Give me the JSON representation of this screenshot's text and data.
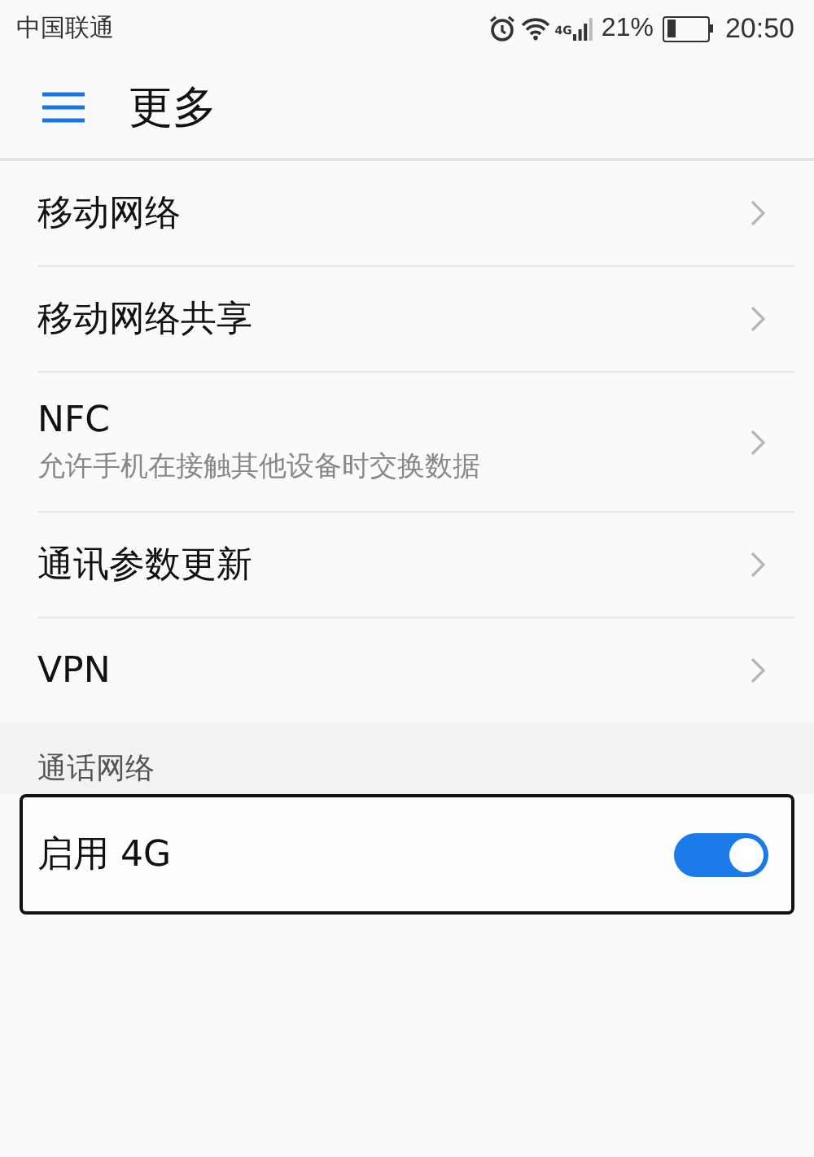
{
  "status_bar": {
    "carrier": "中国联通",
    "network_type": "4G",
    "battery_percent": "21%",
    "time": "20:50"
  },
  "toolbar": {
    "title": "更多"
  },
  "items": [
    {
      "title": "移动网络"
    },
    {
      "title": "移动网络共享"
    },
    {
      "title": "NFC",
      "subtitle": "允许手机在接触其他设备时交换数据"
    },
    {
      "title": "通讯参数更新"
    },
    {
      "title": "VPN"
    }
  ],
  "sections": [
    {
      "header": "通话网络",
      "rows": [
        {
          "label": "启用 4G",
          "on": true,
          "focused": true
        }
      ]
    }
  ]
}
